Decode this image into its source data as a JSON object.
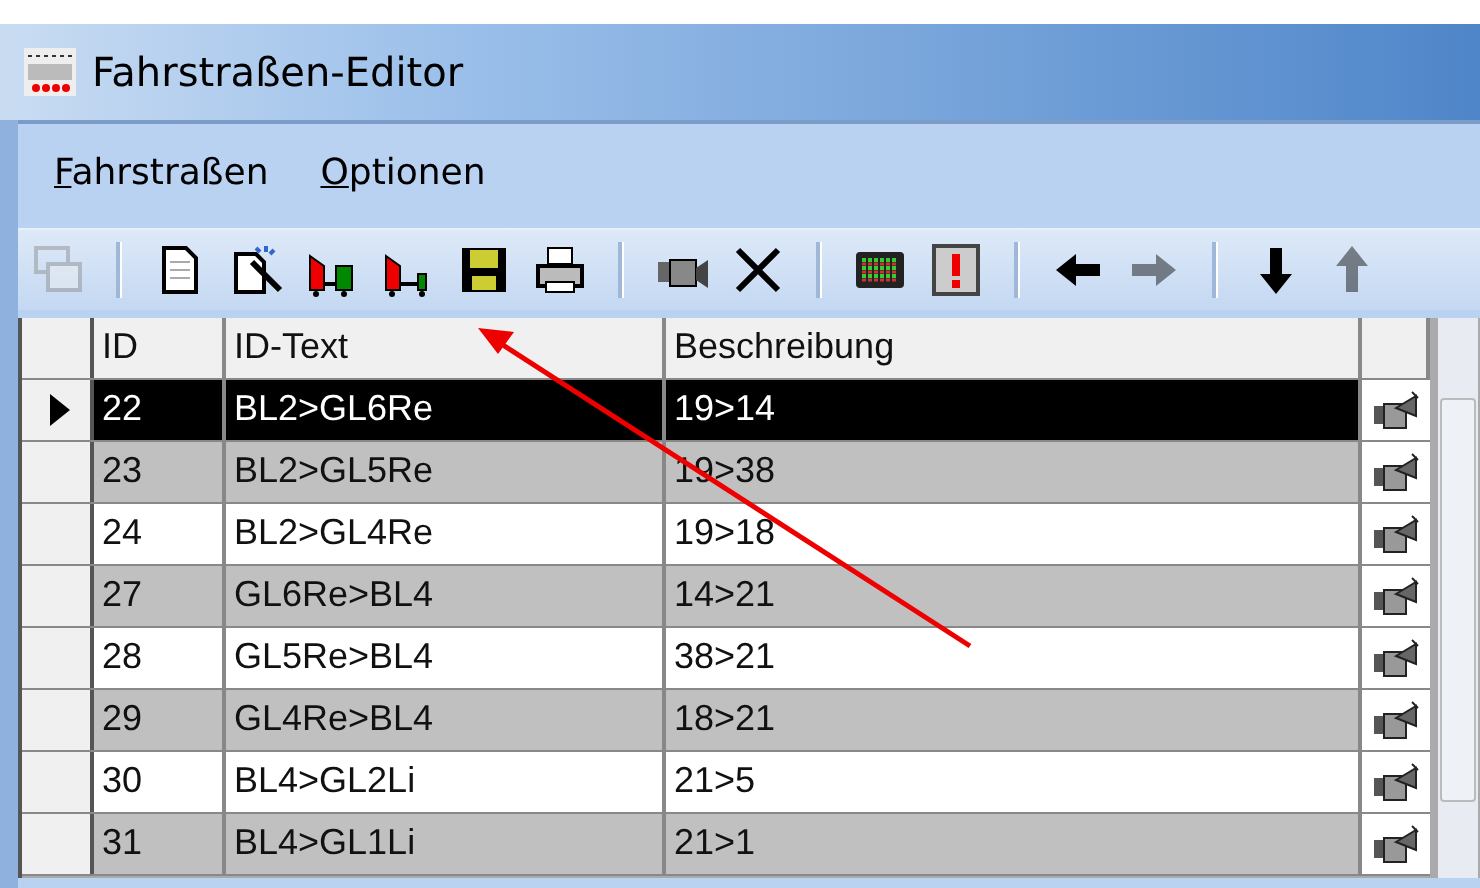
{
  "window": {
    "title": "Fahrstraßen-Editor"
  },
  "menu": [
    "Fahrstraßen",
    "Optionen"
  ],
  "toolbar": [
    {
      "kind": "windows",
      "disabled": true
    },
    {
      "kind": "separator"
    },
    {
      "kind": "new",
      "disabled": false
    },
    {
      "kind": "wizard",
      "disabled": false
    },
    {
      "kind": "train",
      "disabled": false
    },
    {
      "kind": "loco",
      "disabled": false
    },
    {
      "kind": "save",
      "disabled": false
    },
    {
      "kind": "print",
      "disabled": false
    },
    {
      "kind": "separator"
    },
    {
      "kind": "camera",
      "disabled": false
    },
    {
      "kind": "delete",
      "disabled": false
    },
    {
      "kind": "separator"
    },
    {
      "kind": "panel",
      "disabled": false
    },
    {
      "kind": "alert",
      "disabled": false
    },
    {
      "kind": "separator"
    },
    {
      "kind": "left",
      "disabled": false
    },
    {
      "kind": "right",
      "disabled": true
    },
    {
      "kind": "separator"
    },
    {
      "kind": "down",
      "disabled": false
    },
    {
      "kind": "up",
      "disabled": true
    }
  ],
  "table": {
    "columns": [
      "ID",
      "ID-Text",
      "Beschreibung"
    ],
    "rows": [
      {
        "cells": [
          "22",
          "BL2>GL6Re",
          "19>14"
        ],
        "selected": true
      },
      {
        "cells": [
          "23",
          "BL2>GL5Re",
          "19>38"
        ],
        "selected": false
      },
      {
        "cells": [
          "24",
          "BL2>GL4Re",
          "19>18"
        ],
        "selected": false
      },
      {
        "cells": [
          "27",
          "GL6Re>BL4",
          "14>21"
        ],
        "selected": false
      },
      {
        "cells": [
          "28",
          "GL5Re>BL4",
          "38>21"
        ],
        "selected": false
      },
      {
        "cells": [
          "29",
          "GL4Re>BL4",
          "18>21"
        ],
        "selected": false
      },
      {
        "cells": [
          "30",
          "BL4>GL2Li",
          "21>5"
        ],
        "selected": false
      },
      {
        "cells": [
          "31",
          "BL4>GL1Li",
          "21>1"
        ],
        "selected": false
      }
    ]
  },
  "annotation": {
    "kind": "arrow"
  }
}
